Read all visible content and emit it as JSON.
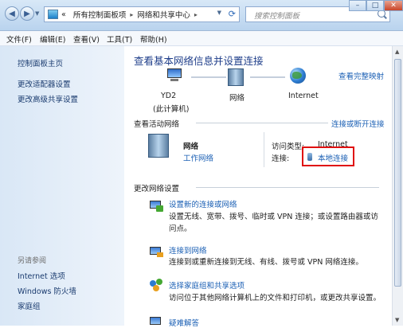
{
  "nav": {
    "back_icon": "back-arrow-icon",
    "forward_icon": "forward-arrow-icon",
    "crumb_root": "«",
    "crumbs": [
      "所有控制面板项",
      "网络和共享中心"
    ],
    "search_placeholder": "搜索控制面板"
  },
  "window_buttons": [
    "minimize",
    "maximize",
    "close"
  ],
  "menu": [
    "文件(F)",
    "编辑(E)",
    "查看(V)",
    "工具(T)",
    "帮助(H)"
  ],
  "sidebar": {
    "links": [
      "控制面板主页",
      "更改适配器设置",
      "更改高级共享设置"
    ],
    "see_also_heading": "另请参阅",
    "see_also": [
      "Internet 选项",
      "Windows 防火墙",
      "家庭组"
    ]
  },
  "main": {
    "title": "查看基本网络信息并设置连接",
    "full_map_link": "查看完整映射",
    "map": {
      "computer_name": "YD2",
      "computer_note": "(此计算机)",
      "network_label": "网络",
      "internet_label": "Internet"
    },
    "active_section": {
      "heading": "查看活动网络",
      "connect_link": "连接或断开连接",
      "network_name": "网络",
      "network_type": "工作网络",
      "access_type_label": "访问类型:",
      "access_type_value": "Internet",
      "connection_label": "连接:",
      "connection_value": "本地连接"
    },
    "change_section": {
      "heading": "更改网络设置",
      "items": [
        {
          "title": "设置新的连接或网络",
          "desc": "设置无线、宽带、拨号、临时或 VPN 连接；或设置路由器或访问点。"
        },
        {
          "title": "连接到网络",
          "desc": "连接到或重新连接到无线、有线、拨号或 VPN 网络连接。"
        },
        {
          "title": "选择家庭组和共享选项",
          "desc": "访问位于其他网络计算机上的文件和打印机，或更改共享设置。"
        },
        {
          "title": "疑难解答",
          "desc": ""
        }
      ]
    }
  }
}
